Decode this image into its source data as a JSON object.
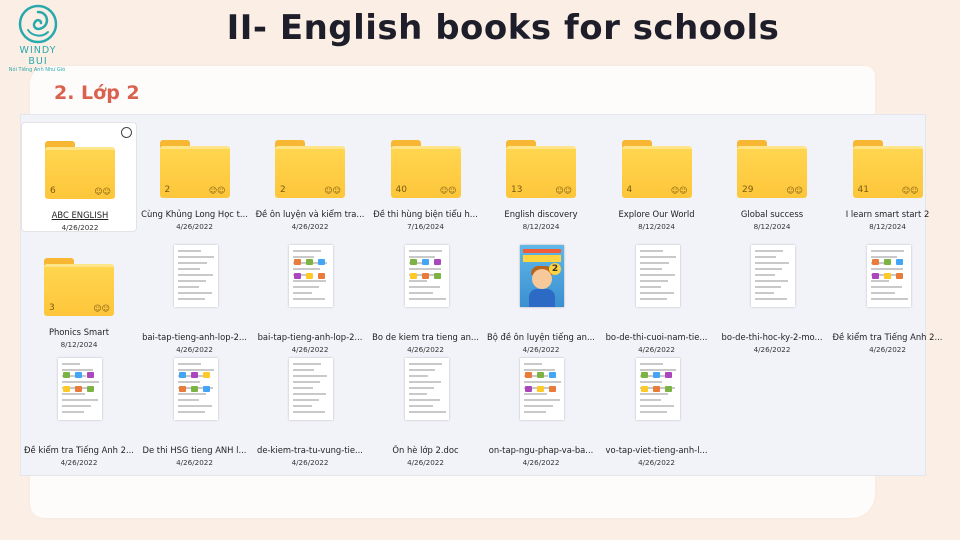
{
  "logo": {
    "name": "WINDY BUI",
    "tagline": "Nói Tiếng Anh Như Gió"
  },
  "slide": {
    "title": "II- English books for schools",
    "subtitle": "2. Lớp 2"
  },
  "colors": {
    "accent_title": "#d9614d",
    "brand": "#2aa9ad",
    "folder": "#ffd54f"
  },
  "items": [
    {
      "kind": "folder",
      "name": "ABC ENGLISH",
      "date": "4/26/2022",
      "count": "6",
      "selected": true
    },
    {
      "kind": "folder",
      "name": "Cùng Khủng Long Học t...",
      "date": "4/26/2022",
      "count": "2"
    },
    {
      "kind": "folder",
      "name": "Đề ôn luyện và kiểm tra...",
      "date": "4/26/2022",
      "count": "2"
    },
    {
      "kind": "folder",
      "name": "Đề thi hùng biện tiểu h...",
      "date": "7/16/2024",
      "count": "40"
    },
    {
      "kind": "folder",
      "name": "English discovery",
      "date": "8/12/2024",
      "count": "13"
    },
    {
      "kind": "folder",
      "name": "Explore Our World",
      "date": "8/12/2024",
      "count": "4"
    },
    {
      "kind": "folder",
      "name": "Global success",
      "date": "8/12/2024",
      "count": "29"
    },
    {
      "kind": "folder",
      "name": "I learn smart start 2",
      "date": "8/12/2024",
      "count": "41"
    },
    {
      "kind": "folder",
      "name": "Phonics Smart",
      "date": "8/12/2024",
      "count": "3"
    },
    {
      "kind": "doc",
      "name": "bai-tap-tieng-anh-lop-2...",
      "date": "4/26/2022"
    },
    {
      "kind": "doc",
      "name": "bai-tap-tieng-anh-lop-2...",
      "date": "4/26/2022"
    },
    {
      "kind": "doc",
      "name": "Bo de kiem tra tieng an...",
      "date": "4/26/2022"
    },
    {
      "kind": "cover",
      "name": "Bộ đề ôn luyện tiếng an...",
      "date": "4/26/2022"
    },
    {
      "kind": "doc",
      "name": "bo-de-thi-cuoi-nam-tie...",
      "date": "4/26/2022"
    },
    {
      "kind": "doc",
      "name": "bo-de-thi-hoc-ky-2-mo...",
      "date": "4/26/2022"
    },
    {
      "kind": "doc",
      "name": "Đề kiểm tra Tiếng Anh 2...",
      "date": "4/26/2022"
    },
    {
      "kind": "doc",
      "name": "Đề kiểm tra Tiếng Anh 2...",
      "date": "4/26/2022"
    },
    {
      "kind": "doc",
      "name": "De thi HSG tieng ANH l...",
      "date": "4/26/2022"
    },
    {
      "kind": "doc",
      "name": "de-kiem-tra-tu-vung-tie...",
      "date": "4/26/2022"
    },
    {
      "kind": "doc",
      "name": "Ôn hè lớp 2.doc",
      "date": "4/26/2022"
    },
    {
      "kind": "doc",
      "name": "on-tap-ngu-phap-va-ba...",
      "date": "4/26/2022"
    },
    {
      "kind": "doc",
      "name": "vo-tap-viet-tieng-anh-l...",
      "date": "4/26/2022"
    }
  ]
}
